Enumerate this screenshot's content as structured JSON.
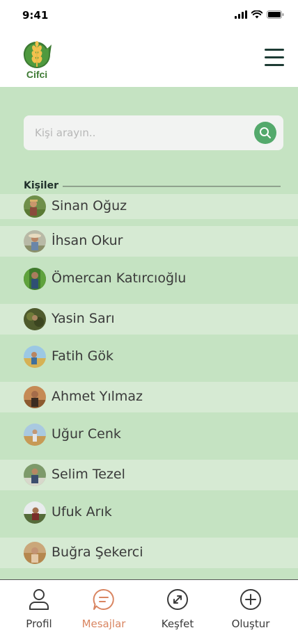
{
  "status_bar": {
    "time": "9:41"
  },
  "header": {
    "logo_text": "Cifci"
  },
  "search": {
    "placeholder": "Kişi arayın.."
  },
  "contacts_section": {
    "title": "Kişiler"
  },
  "contacts": [
    {
      "name": "Sinan Oğuz"
    },
    {
      "name": "İhsan Okur"
    },
    {
      "name": "Ömercan Katırcıoğlu"
    },
    {
      "name": "Yasin Sarı"
    },
    {
      "name": "Fatih Gök"
    },
    {
      "name": "Ahmet Yılmaz"
    },
    {
      "name": "Uğur Cenk"
    },
    {
      "name": "Selim Tezel"
    },
    {
      "name": "Ufuk Arık"
    },
    {
      "name": "Buğra Şekerci"
    }
  ],
  "nav": {
    "profile": "Profil",
    "messages": "Mesajlar",
    "explore": "Keşfet",
    "create": "Oluştur"
  },
  "colors": {
    "accent": "#d98561",
    "primary_green": "#54a96c",
    "background_green": "#c5e3c2",
    "row_light": "#d6ead3"
  }
}
